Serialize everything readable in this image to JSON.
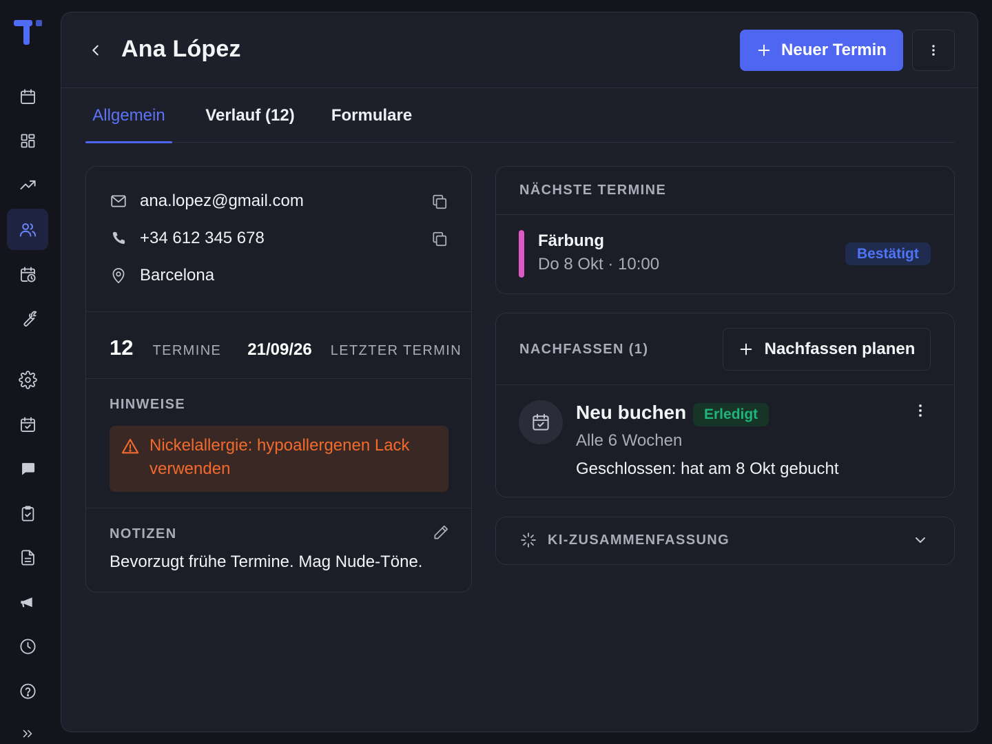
{
  "app": {
    "logo": "app-logo",
    "accent": "#4f66f0"
  },
  "sidebar": {
    "items": [
      {
        "name": "calendar",
        "icon": "calendar-icon",
        "active": false
      },
      {
        "name": "dashboard",
        "icon": "grid-icon",
        "active": false
      },
      {
        "name": "analytics",
        "icon": "trending-up-icon",
        "active": false
      },
      {
        "name": "clients",
        "icon": "users-icon",
        "active": true
      },
      {
        "name": "schedule",
        "icon": "calendar-clock-icon",
        "active": false
      },
      {
        "name": "tools",
        "icon": "wrench-icon",
        "active": false
      },
      {
        "name": "settings",
        "icon": "gear-icon",
        "active": false
      },
      {
        "name": "bookings",
        "icon": "calendar-check-icon",
        "active": false
      },
      {
        "name": "messages",
        "icon": "message-icon",
        "active": false
      },
      {
        "name": "tasks",
        "icon": "clipboard-check-icon",
        "active": false
      },
      {
        "name": "documents",
        "icon": "document-icon",
        "active": false
      },
      {
        "name": "marketing",
        "icon": "megaphone-icon",
        "active": false
      },
      {
        "name": "history",
        "icon": "clock-icon",
        "active": false
      },
      {
        "name": "help",
        "icon": "help-icon",
        "active": false
      },
      {
        "name": "expand",
        "icon": "chevrons-right-icon",
        "active": false
      }
    ]
  },
  "header": {
    "title": "Ana López",
    "new_appointment_label": "Neuer Termin"
  },
  "tabs": [
    {
      "label": "Allgemein",
      "active": true
    },
    {
      "label": "Verlauf (12)",
      "active": false
    },
    {
      "label": "Formulare",
      "active": false
    }
  ],
  "contact": {
    "email": "ana.lopez@gmail.com",
    "phone": "+34 612 345 678",
    "city": "Barcelona"
  },
  "stats": {
    "appointments_count": "12",
    "appointments_label": "TERMINE",
    "last_date": "21/09/26",
    "last_label": "LETZTER TERMIN"
  },
  "hints": {
    "label": "HINWEISE",
    "alert_text": "Nickelallergie: hypoallergenen Lack verwenden",
    "alert_color": "#f26a2c"
  },
  "notes": {
    "label": "NOTIZEN",
    "text": "Bevorzugt frühe Termine. Mag Nude-Töne."
  },
  "upcoming": {
    "label": "NÄCHSTE TERMINE",
    "appointment": {
      "title": "Färbung",
      "time": "Do 8 Okt · 10:00",
      "status": "Bestätigt",
      "color": "#e058c5"
    }
  },
  "followup": {
    "label": "NACHFASSEN (1)",
    "plan_label": "Nachfassen planen",
    "item": {
      "title": "Neu buchen",
      "status": "Erledigt",
      "interval": "Alle 6 Wochen",
      "note": "Geschlossen: hat am 8 Okt gebucht"
    }
  },
  "ai_summary": {
    "label": "KI-ZUSAMMENFASSUNG"
  }
}
